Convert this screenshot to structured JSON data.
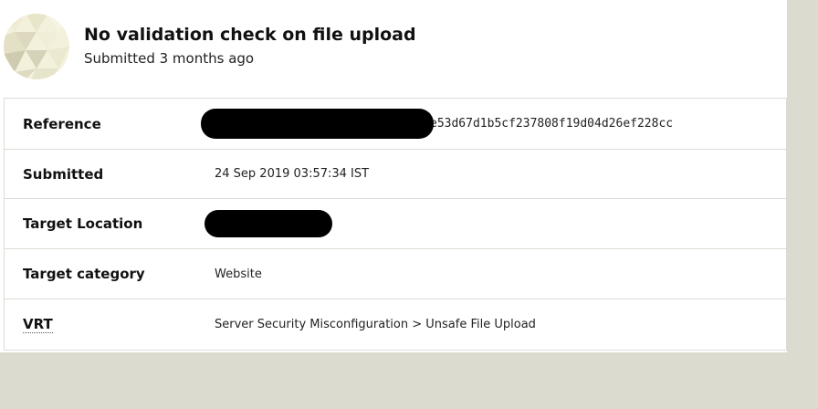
{
  "header": {
    "title": "No validation check on file upload",
    "subtitle": "Submitted 3 months ago"
  },
  "details": [
    {
      "label": "Reference",
      "value": "e53d67d1b5cf237808f19d04d26ef228cc",
      "redacted": true
    },
    {
      "label": "Submitted",
      "value": "24 Sep 2019 03:57:34 IST",
      "redacted": false
    },
    {
      "label": "Target Location",
      "value": "",
      "redacted": true
    },
    {
      "label": "Target category",
      "value": "Website",
      "redacted": false
    },
    {
      "label": "VRT",
      "value": "Server Security Misconfiguration > Unsafe File Upload",
      "redacted": false
    }
  ],
  "colors": {
    "page_bg": "#dcdbcf",
    "panel_bg": "#ffffff",
    "redaction": "#000000"
  }
}
